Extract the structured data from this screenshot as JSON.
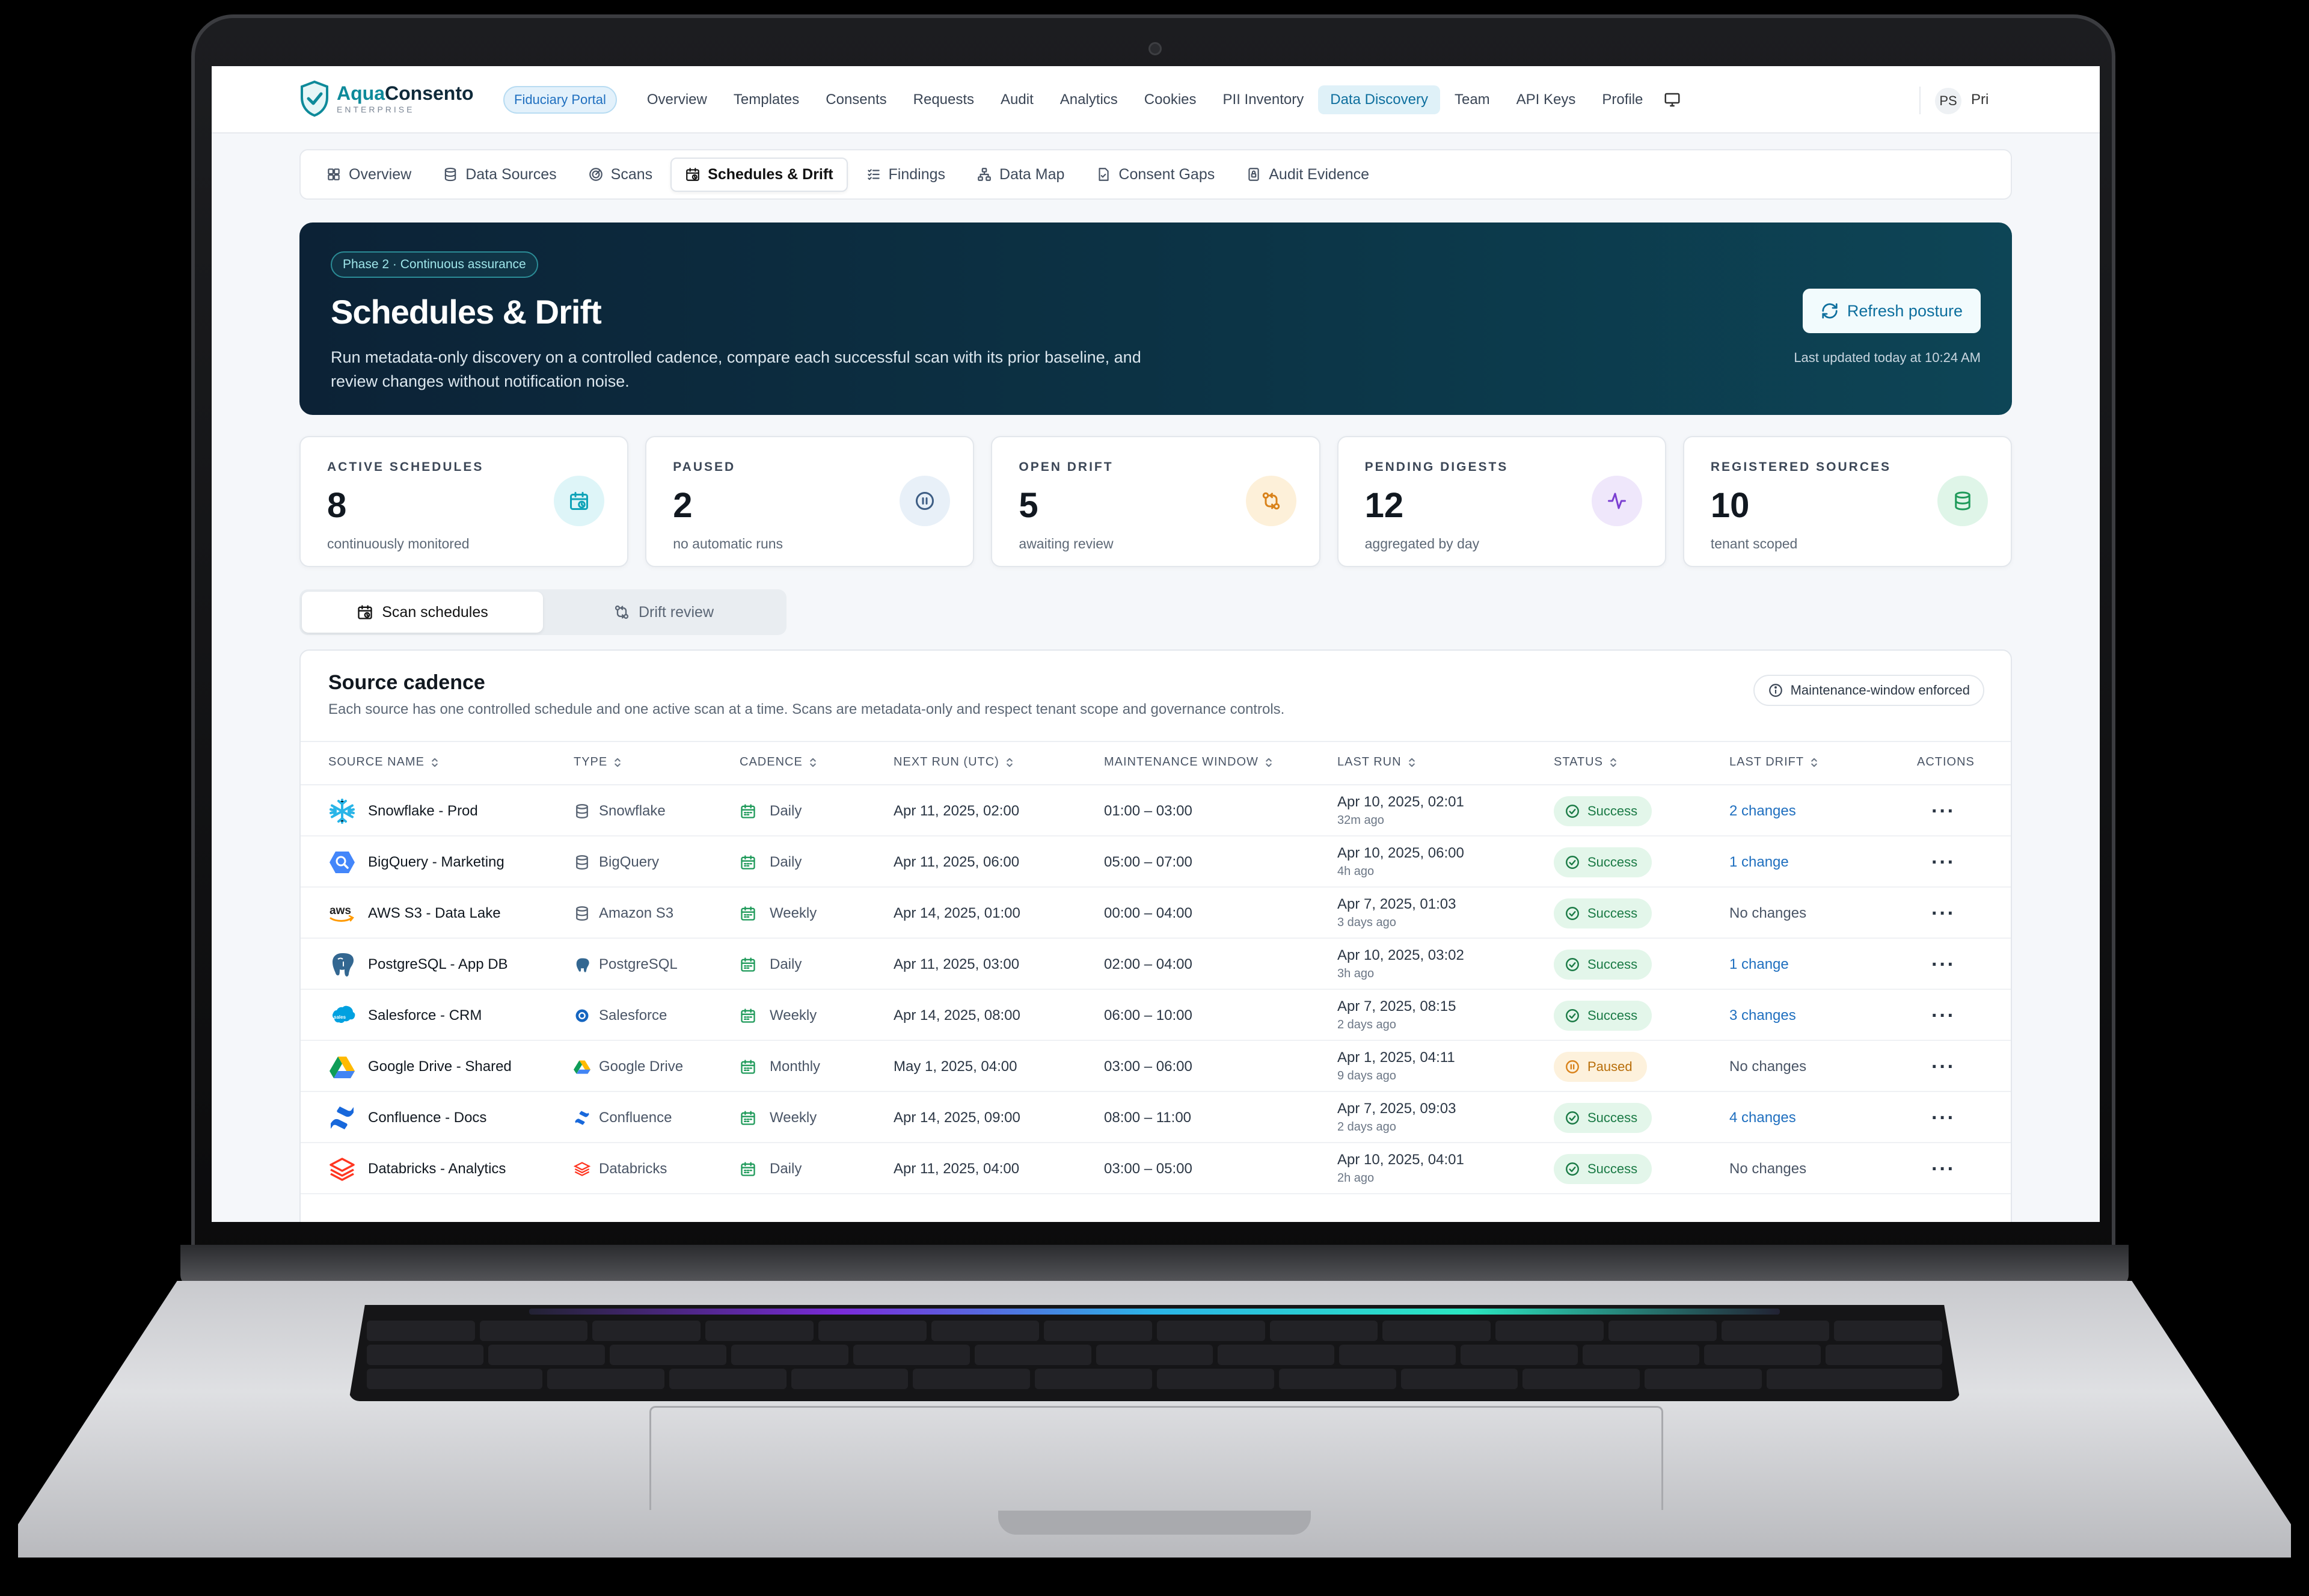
{
  "brand": {
    "name_primary": "Aqua",
    "name_secondary": "Consento",
    "sub": "ENTERPRISE",
    "portal_pill": "Fiduciary Portal"
  },
  "topnav": {
    "items": [
      "Overview",
      "Templates",
      "Consents",
      "Requests",
      "Audit",
      "Analytics",
      "Cookies",
      "PII Inventory",
      "Data Discovery",
      "Team",
      "API Keys",
      "Profile"
    ],
    "active": "Data Discovery",
    "user_initials": "PS",
    "user_name": "Pri"
  },
  "subnav": {
    "items": [
      "Overview",
      "Data Sources",
      "Scans",
      "Schedules & Drift",
      "Findings",
      "Data Map",
      "Consent Gaps",
      "Audit Evidence"
    ],
    "active": "Schedules & Drift"
  },
  "hero": {
    "badge": "Phase 2 · Continuous assurance",
    "title": "Schedules & Drift",
    "description": "Run metadata-only discovery on a controlled cadence, compare each successful scan with its prior baseline, and review changes without notification noise.",
    "refresh_label": "Refresh posture",
    "last_updated": "Last updated today at 10:24 AM"
  },
  "kpis": [
    {
      "label": "ACTIVE SCHEDULES",
      "value": "8",
      "sub": "continuously monitored",
      "icon": "calendar-clock-icon",
      "color": "#0fa3b8",
      "bg": "#def5f8"
    },
    {
      "label": "PAUSED",
      "value": "2",
      "sub": "no automatic runs",
      "icon": "pause-icon",
      "color": "#3d5d84",
      "bg": "#e8f0f8"
    },
    {
      "label": "OPEN DRIFT",
      "value": "5",
      "sub": "awaiting review",
      "icon": "git-compare-icon",
      "color": "#d9821a",
      "bg": "#fdf0d9"
    },
    {
      "label": "PENDING DIGESTS",
      "value": "12",
      "sub": "aggregated by day",
      "icon": "activity-icon",
      "color": "#7b3fd1",
      "bg": "#efe7fb"
    },
    {
      "label": "REGISTERED SOURCES",
      "value": "10",
      "sub": "tenant scoped",
      "icon": "database-icon",
      "color": "#1f9a5a",
      "bg": "#dff5e8"
    }
  ],
  "tabs": {
    "items": [
      "Scan schedules",
      "Drift review"
    ],
    "active": "Scan schedules"
  },
  "card": {
    "title": "Source cadence",
    "description": "Each source has one controlled schedule and one active scan at a time. Scans are metadata-only and respect tenant scope and governance controls.",
    "badge": "Maintenance-window enforced"
  },
  "table": {
    "headers": [
      "SOURCE NAME",
      "TYPE",
      "CADENCE",
      "NEXT RUN (UTC)",
      "MAINTENANCE WINDOW",
      "LAST RUN",
      "STATUS",
      "LAST DRIFT",
      "ACTIONS"
    ],
    "rows": [
      {
        "source": "Snowflake - Prod",
        "logo": "snowflake",
        "type": "Snowflake",
        "type_icon": "database",
        "cadence": "Daily",
        "next_run": "Apr 11, 2025, 02:00",
        "window": "01:00 – 03:00",
        "last_run": "Apr 10, 2025, 02:01",
        "ago": "32m ago",
        "status": "Success",
        "drift": "2 changes"
      },
      {
        "source": "BigQuery - Marketing",
        "logo": "bigquery",
        "type": "BigQuery",
        "type_icon": "database",
        "cadence": "Daily",
        "next_run": "Apr 11, 2025, 06:00",
        "window": "05:00 – 07:00",
        "last_run": "Apr 10, 2025, 06:00",
        "ago": "4h ago",
        "status": "Success",
        "drift": "1 change"
      },
      {
        "source": "AWS S3 - Data Lake",
        "logo": "aws",
        "type": "Amazon S3",
        "type_icon": "database",
        "cadence": "Weekly",
        "next_run": "Apr 14, 2025, 01:00",
        "window": "00:00 – 04:00",
        "last_run": "Apr 7, 2025, 01:03",
        "ago": "3 days ago",
        "status": "Success",
        "drift": "No changes"
      },
      {
        "source": "PostgreSQL - App DB",
        "logo": "postgres",
        "type": "PostgreSQL",
        "type_icon": "postgres",
        "cadence": "Daily",
        "next_run": "Apr 11, 2025, 03:00",
        "window": "02:00 – 04:00",
        "last_run": "Apr 10, 2025, 03:02",
        "ago": "3h ago",
        "status": "Success",
        "drift": "1 change"
      },
      {
        "source": "Salesforce - CRM",
        "logo": "salesforce",
        "type": "Salesforce",
        "type_icon": "salesforce",
        "cadence": "Weekly",
        "next_run": "Apr 14, 2025, 08:00",
        "window": "06:00 – 10:00",
        "last_run": "Apr 7, 2025, 08:15",
        "ago": "2 days ago",
        "status": "Success",
        "drift": "3 changes"
      },
      {
        "source": "Google Drive - Shared",
        "logo": "gdrive",
        "type": "Google Drive",
        "type_icon": "gdrive",
        "cadence": "Monthly",
        "next_run": "May 1, 2025, 04:00",
        "window": "03:00 – 06:00",
        "last_run": "Apr 1, 2025, 04:11",
        "ago": "9 days ago",
        "status": "Paused",
        "drift": "No changes"
      },
      {
        "source": "Confluence - Docs",
        "logo": "confluence",
        "type": "Confluence",
        "type_icon": "confluence",
        "cadence": "Weekly",
        "next_run": "Apr 14, 2025, 09:00",
        "window": "08:00 – 11:00",
        "last_run": "Apr 7, 2025, 09:03",
        "ago": "2 days ago",
        "status": "Success",
        "drift": "4 changes"
      },
      {
        "source": "Databricks - Analytics",
        "logo": "databricks",
        "type": "Databricks",
        "type_icon": "databricks",
        "cadence": "Daily",
        "next_run": "Apr 11, 2025, 04:00",
        "window": "03:00 – 05:00",
        "last_run": "Apr 10, 2025, 04:01",
        "ago": "2h ago",
        "status": "Success",
        "drift": "No changes"
      }
    ]
  }
}
